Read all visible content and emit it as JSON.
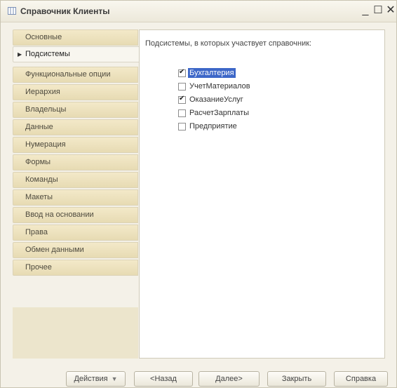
{
  "window": {
    "title": "Справочник Клиенты",
    "controls": {
      "minimize": "_",
      "maximize": "☐",
      "close": "✕"
    }
  },
  "tabs": [
    {
      "label": "Основные",
      "active": false
    },
    {
      "label": "Подсистемы",
      "active": true
    },
    {
      "label": "Функциональные опции",
      "active": false
    },
    {
      "label": "Иерархия",
      "active": false
    },
    {
      "label": "Владельцы",
      "active": false
    },
    {
      "label": "Данные",
      "active": false
    },
    {
      "label": "Нумерация",
      "active": false
    },
    {
      "label": "Формы",
      "active": false
    },
    {
      "label": "Команды",
      "active": false
    },
    {
      "label": "Макеты",
      "active": false
    },
    {
      "label": "Ввод на основании",
      "active": false
    },
    {
      "label": "Права",
      "active": false
    },
    {
      "label": "Обмен данными",
      "active": false
    },
    {
      "label": "Прочее",
      "active": false
    }
  ],
  "panel": {
    "label": "Подсистемы, в которых участвует справочник:",
    "subsystems": [
      {
        "label": "Бухгалтерия",
        "checked": true,
        "selected": true
      },
      {
        "label": "УчетМатериалов",
        "checked": false,
        "selected": false
      },
      {
        "label": "ОказаниеУслуг",
        "checked": true,
        "selected": false
      },
      {
        "label": "РасчетЗарплаты",
        "checked": false,
        "selected": false
      },
      {
        "label": "Предприятие",
        "checked": false,
        "selected": false
      }
    ]
  },
  "footer": {
    "actions_label": "Действия",
    "back_label": "<Назад",
    "next_label": "Далее>",
    "close_label": "Закрыть",
    "help_label": "Справка"
  },
  "colors": {
    "tab_background": "#e7dbb3",
    "selection": "#3d67c8"
  }
}
